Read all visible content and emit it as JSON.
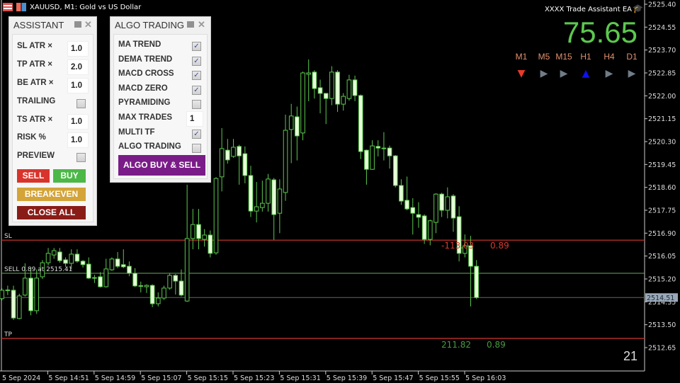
{
  "window": {
    "title": "XAUUSD, M1:  Gold vs US Dollar"
  },
  "ea": {
    "name": "XXXX Trade Assistant EA",
    "value": "75.65",
    "counter": "21",
    "value_color": "#5cc84e",
    "timeframes": [
      {
        "label": "M1",
        "signal": "down",
        "color": "#e83a2a"
      },
      {
        "label": "M5",
        "signal": "neutral",
        "color": "#707c88"
      },
      {
        "label": "M15",
        "signal": "neutral",
        "color": "#707c88"
      },
      {
        "label": "H1",
        "signal": "up",
        "color": "#1010f0"
      },
      {
        "label": "H4",
        "signal": "neutral",
        "color": "#707c88"
      },
      {
        "label": "D1",
        "signal": "neutral",
        "color": "#707c88"
      }
    ]
  },
  "assistant": {
    "title": "ASSISTANT",
    "sl_label": "SL ATR ×",
    "sl_value": "1.0",
    "tp_label": "TP ATR ×",
    "tp_value": "2.0",
    "be_label": "BE ATR ×",
    "be_value": "1.0",
    "trailing_label": "TRAILING",
    "trailing_checked": false,
    "ts_label": "TS ATR ×",
    "ts_value": "1.0",
    "risk_label": "RISK %",
    "risk_value": "1.0",
    "preview_label": "PREVIEW",
    "preview_checked": false,
    "sell": "SELL",
    "buy": "BUY",
    "breakeven": "BREAKEVEN",
    "close_all": "CLOSE ALL"
  },
  "algo": {
    "title": "ALGO TRADING",
    "options": [
      {
        "label": "MA TREND",
        "checked": true
      },
      {
        "label": "DEMA TREND",
        "checked": true
      },
      {
        "label": "MACD CROSS",
        "checked": true
      },
      {
        "label": "MACD ZERO",
        "checked": true
      },
      {
        "label": "PYRAMIDING",
        "checked": false
      },
      {
        "label": "MAX TRADES",
        "value": "1"
      },
      {
        "label": "MULTI TF",
        "checked": true
      },
      {
        "label": "ALGO TRADING",
        "checked": false
      }
    ],
    "button": "ALGO BUY & SELL"
  },
  "lines": {
    "sl": {
      "label": "SL",
      "price": 2516.64,
      "color": "#c0302a",
      "pnl": "-113.03",
      "lots": "0.89"
    },
    "entry": {
      "label": "SELL 0.89 at 2515.41",
      "price": 2515.41,
      "color": "#6aa860"
    },
    "tp": {
      "label": "TP",
      "price": 2512.99,
      "color": "#c0302a",
      "pnl": "211.82",
      "lots": "0.89"
    },
    "bid": {
      "price": 2514.51,
      "label": "2514.51"
    }
  },
  "chart_data": {
    "type": "candlestick",
    "symbol": "XAUUSD",
    "timeframe": "M1",
    "ylim": [
      2512.65,
      2525.4
    ],
    "y_ticks": [
      "2525.40",
      "2524.55",
      "2523.70",
      "2522.85",
      "2522.00",
      "2521.15",
      "2520.30",
      "2519.45",
      "2518.60",
      "2517.75",
      "2516.90",
      "2516.05",
      "2515.20",
      "2514.35",
      "2513.50",
      "2512.65"
    ],
    "x_ticks": [
      "5 Sep 2024",
      "5 Sep 14:51",
      "5 Sep 14:59",
      "5 Sep 15:07",
      "5 Sep 15:15",
      "5 Sep 15:23",
      "5 Sep 15:31",
      "5 Sep 15:39",
      "5 Sep 15:47",
      "5 Sep 15:55",
      "5 Sep 16:03"
    ],
    "ohlc": [
      [
        2514.47,
        2514.85,
        2514.4,
        2514.78
      ],
      [
        2514.78,
        2514.95,
        2514.6,
        2514.79
      ],
      [
        2514.78,
        2514.95,
        2513.68,
        2513.75
      ],
      [
        2513.73,
        2514.65,
        2513.7,
        2514.57
      ],
      [
        2514.6,
        2515.78,
        2514.55,
        2515.23
      ],
      [
        2515.23,
        2515.6,
        2513.85,
        2514.02
      ],
      [
        2514.02,
        2515.55,
        2513.9,
        2515.23
      ],
      [
        2515.28,
        2515.9,
        2515.2,
        2515.8
      ],
      [
        2515.8,
        2516.35,
        2515.7,
        2516.15
      ],
      [
        2516.09,
        2516.35,
        2515.95,
        2516.25
      ],
      [
        2516.2,
        2516.35,
        2515.8,
        2515.88
      ],
      [
        2515.91,
        2516.0,
        2515.65,
        2515.78
      ],
      [
        2515.78,
        2516.3,
        2515.55,
        2516.12
      ],
      [
        2516.12,
        2516.3,
        2515.8,
        2515.86
      ],
      [
        2515.86,
        2515.9,
        2515.62,
        2515.73
      ],
      [
        2515.75,
        2516.0,
        2515.2,
        2515.23
      ],
      [
        2515.25,
        2515.35,
        2515.05,
        2515.24
      ],
      [
        2515.28,
        2515.45,
        2514.88,
        2514.91
      ],
      [
        2514.91,
        2515.95,
        2514.88,
        2515.57
      ],
      [
        2515.54,
        2516.0,
        2515.5,
        2515.94
      ],
      [
        2515.94,
        2516.2,
        2515.6,
        2515.67
      ],
      [
        2515.73,
        2516.3,
        2515.6,
        2515.65
      ],
      [
        2515.67,
        2515.85,
        2515.3,
        2515.41
      ],
      [
        2515.41,
        2515.6,
        2514.9,
        2514.94
      ],
      [
        2514.95,
        2515.1,
        2514.7,
        2514.94
      ],
      [
        2514.91,
        2515.0,
        2514.68,
        2514.96
      ],
      [
        2514.96,
        2515.0,
        2514.15,
        2514.28
      ],
      [
        2514.28,
        2514.7,
        2514.18,
        2514.49
      ],
      [
        2514.49,
        2514.95,
        2514.42,
        2514.86
      ],
      [
        2514.86,
        2515.4,
        2514.8,
        2515.33
      ],
      [
        2515.33,
        2515.38,
        2514.62,
        2515.12
      ],
      [
        2515.12,
        2515.55,
        2514.55,
        2514.6
      ],
      [
        2514.38,
        2518.7,
        2514.35,
        2516.7
      ],
      [
        2516.7,
        2517.8,
        2516.3,
        2517.22
      ],
      [
        2517.22,
        2517.8,
        2516.3,
        2516.7
      ],
      [
        2516.67,
        2517.05,
        2516.4,
        2516.83
      ],
      [
        2516.83,
        2517.0,
        2516.0,
        2516.15
      ],
      [
        2516.17,
        2518.98,
        2516.1,
        2518.93
      ],
      [
        2518.99,
        2520.8,
        2518.45,
        2520.04
      ],
      [
        2519.98,
        2520.4,
        2519.48,
        2519.62
      ],
      [
        2519.75,
        2520.4,
        2519.7,
        2520.09
      ],
      [
        2520.12,
        2520.18,
        2518.7,
        2519.77
      ],
      [
        2519.85,
        2520.12,
        2518.75,
        2519.04
      ],
      [
        2519.04,
        2519.4,
        2517.5,
        2517.72
      ],
      [
        2517.72,
        2518.8,
        2517.3,
        2517.88
      ],
      [
        2517.85,
        2518.85,
        2517.7,
        2518.01
      ],
      [
        2518.01,
        2519.1,
        2517.7,
        2518.91
      ],
      [
        2518.88,
        2518.95,
        2516.65,
        2517.59
      ],
      [
        2517.64,
        2518.9,
        2516.9,
        2518.54
      ],
      [
        2518.41,
        2521.3,
        2518.1,
        2520.72
      ],
      [
        2520.75,
        2521.7,
        2519.5,
        2521.25
      ],
      [
        2521.22,
        2521.6,
        2519.6,
        2520.51
      ],
      [
        2520.62,
        2522.9,
        2520.35,
        2522.85
      ],
      [
        2522.8,
        2523.35,
        2521.8,
        2522.85
      ],
      [
        2522.88,
        2522.95,
        2521.9,
        2522.27
      ],
      [
        2522.3,
        2522.6,
        2521.35,
        2522.09
      ],
      [
        2522.09,
        2522.1,
        2520.95,
        2521.9
      ],
      [
        2521.9,
        2523.1,
        2521.65,
        2522.88
      ],
      [
        2522.88,
        2522.95,
        2521.4,
        2521.69
      ],
      [
        2521.69,
        2522.1,
        2521.45,
        2521.98
      ],
      [
        2521.9,
        2522.78,
        2521.82,
        2522.59
      ],
      [
        2522.59,
        2522.75,
        2521.8,
        2522.01
      ],
      [
        2522.01,
        2522.05,
        2519.65,
        2519.93
      ],
      [
        2519.98,
        2520.0,
        2518.7,
        2519.27
      ],
      [
        2519.27,
        2520.35,
        2519.25,
        2520.14
      ],
      [
        2520.12,
        2520.35,
        2519.75,
        2520.06
      ],
      [
        2520.06,
        2520.65,
        2519.6,
        2520.05
      ],
      [
        2520.06,
        2520.15,
        2519.3,
        2519.77
      ],
      [
        2519.77,
        2519.8,
        2518.6,
        2518.67
      ],
      [
        2518.67,
        2518.9,
        2517.95,
        2518.09
      ],
      [
        2518.12,
        2519.0,
        2517.75,
        2517.8
      ],
      [
        2517.85,
        2518.2,
        2516.85,
        2517.64
      ],
      [
        2517.59,
        2518.05,
        2517.1,
        2517.49
      ],
      [
        2517.54,
        2517.6,
        2516.5,
        2516.67
      ],
      [
        2516.67,
        2517.4,
        2516.45,
        2517.36
      ],
      [
        2517.3,
        2518.38,
        2516.9,
        2518.35
      ],
      [
        2518.35,
        2518.4,
        2517.5,
        2517.75
      ],
      [
        2517.75,
        2518.6,
        2517.45,
        2518.25
      ],
      [
        2518.28,
        2518.35,
        2516.95,
        2517.46
      ],
      [
        2517.51,
        2517.9,
        2515.85,
        2516.15
      ],
      [
        2516.15,
        2516.85,
        2516.0,
        2516.43
      ],
      [
        2516.43,
        2516.8,
        2514.18,
        2515.67
      ],
      [
        2515.67,
        2515.9,
        2514.45,
        2514.51
      ]
    ],
    "bull_color": "#5cc84e",
    "bear_fill": "#e6ffd8",
    "grid": false
  }
}
